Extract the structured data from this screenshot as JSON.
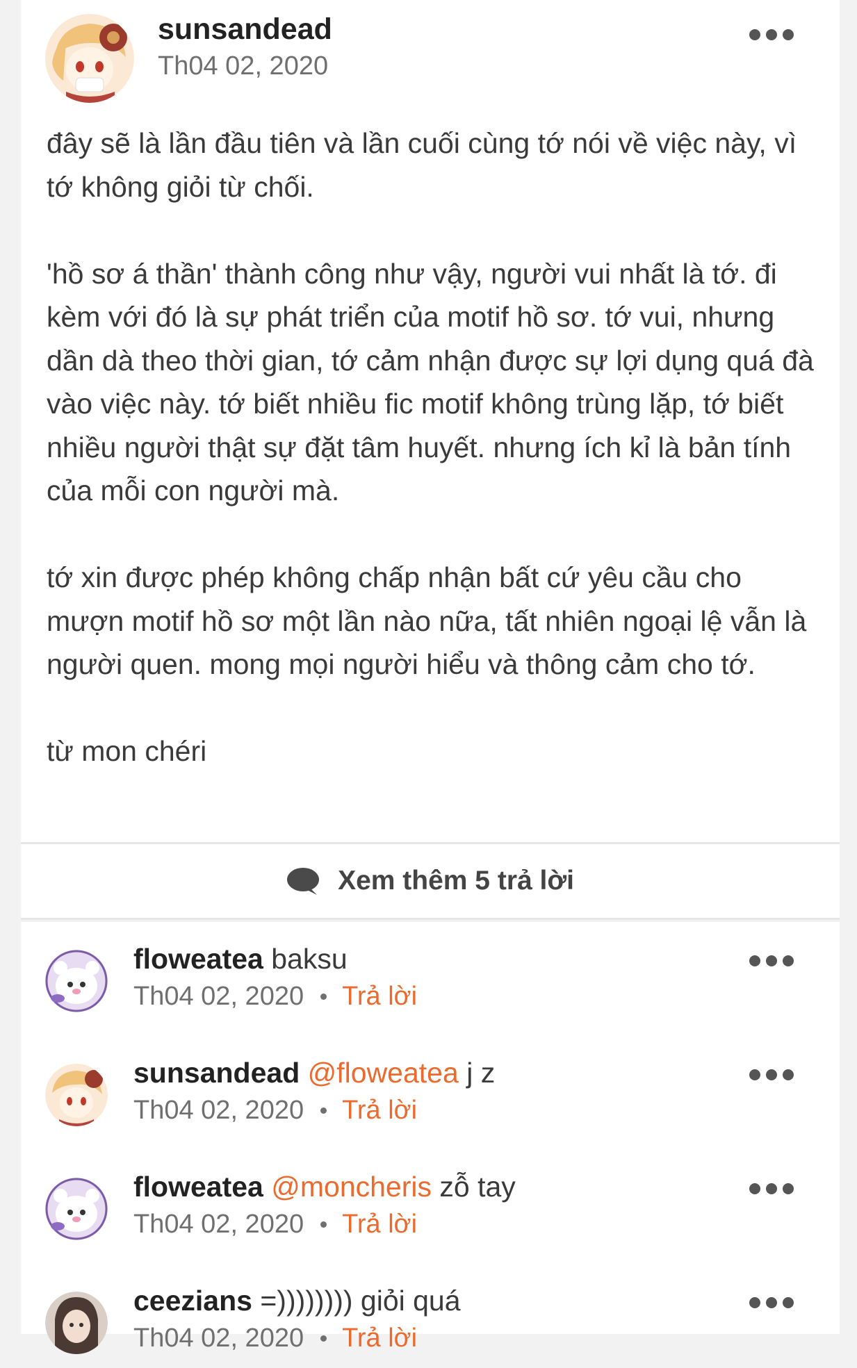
{
  "post": {
    "author": "sunsandead",
    "date": "Th04 02, 2020",
    "paragraphs": [
      "đây sẽ là lần đầu tiên và lần cuối cùng tớ nói về việc này, vì tớ không giỏi từ chối.",
      "'hồ sơ á thần' thành công như vậy, người vui nhất là tớ. đi kèm với đó là sự phát triển của motif hồ sơ. tớ vui, nhưng dần dà theo thời gian, tớ cảm nhận được sự lợi dụng quá đà vào việc này. tớ biết nhiều fic motif không trùng lặp, tớ biết nhiều người thật sự đặt tâm huyết. nhưng ích kỉ là bản tính của mỗi con người mà.",
      "tớ xin được phép không chấp nhận bất cứ yêu cầu cho mượn motif hồ sơ một lần nào nữa, tất nhiên ngoại lệ vẫn là người quen. mong mọi người hiểu và thông cảm cho tớ.",
      "từ mon chéri"
    ]
  },
  "more_replies": {
    "label": "Xem thêm 5 trả lời",
    "icon": "chat-bubble-icon"
  },
  "replies": [
    {
      "user": "floweatea",
      "mention": "",
      "text": "baksu",
      "date": "Th04 02, 2020",
      "reply_label": "Trả lời"
    },
    {
      "user": "sunsandead",
      "mention": "@floweatea",
      "text": "j z",
      "date": "Th04 02, 2020",
      "reply_label": "Trả lời"
    },
    {
      "user": "floweatea",
      "mention": "@moncheris",
      "text": "zỗ tay",
      "date": "Th04 02, 2020",
      "reply_label": "Trả lời"
    },
    {
      "user": "ceezians",
      "mention": "",
      "text": "=)))))))) giỏi quá",
      "date": "Th04 02, 2020",
      "reply_label": "Trả lời"
    }
  ],
  "colors": {
    "accent": "#ea6b2d",
    "text": "#3a3a3a",
    "muted": "#6f6f6f"
  }
}
